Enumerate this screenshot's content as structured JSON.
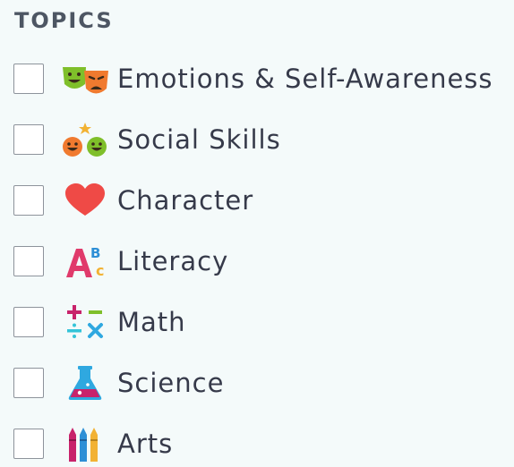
{
  "heading": "TOPICS",
  "topics": [
    {
      "label": "Emotions & Self-Awareness",
      "icon": "theater-masks-icon",
      "checked": false
    },
    {
      "label": "Social Skills",
      "icon": "two-smiley-faces-icon",
      "checked": false
    },
    {
      "label": "Character",
      "icon": "heart-icon",
      "checked": false
    },
    {
      "label": "Literacy",
      "icon": "abc-letters-icon",
      "checked": false
    },
    {
      "label": "Math",
      "icon": "math-operators-icon",
      "checked": false
    },
    {
      "label": "Science",
      "icon": "flask-icon",
      "checked": false
    },
    {
      "label": "Arts",
      "icon": "crayons-icon",
      "checked": false
    }
  ],
  "colors": {
    "background": "#f4fafa",
    "heading": "#4d5663",
    "label": "#363a4a",
    "checkbox_border": "#8d939b"
  }
}
